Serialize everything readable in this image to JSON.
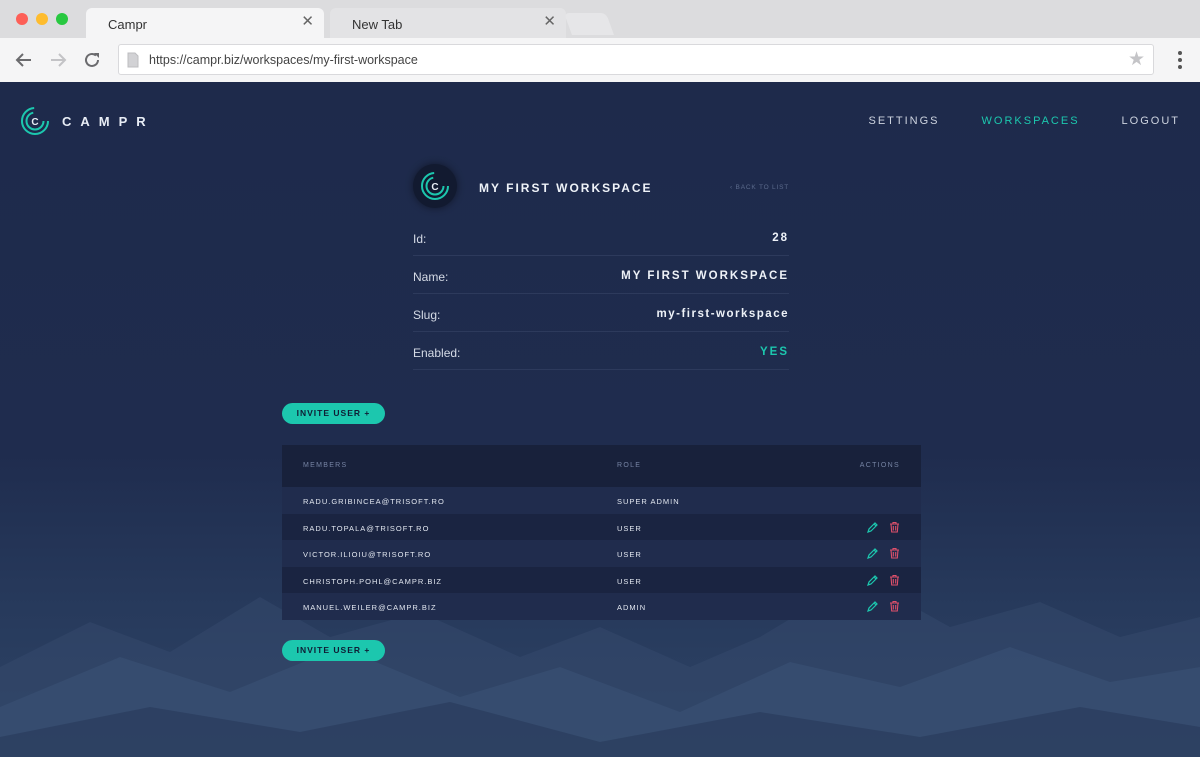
{
  "browser": {
    "tabs": [
      {
        "title": "Campr",
        "active": true
      },
      {
        "title": "New Tab",
        "active": false
      }
    ],
    "url": "https://campr.biz/workspaces/my-first-workspace"
  },
  "app": {
    "logo_text": "CAMPR",
    "nav": [
      {
        "label": "SETTINGS",
        "active": false
      },
      {
        "label": "WORKSPACES",
        "active": true
      },
      {
        "label": "LOGOUT",
        "active": false
      }
    ],
    "accent_color": "#1cc7ae"
  },
  "workspace": {
    "title": "MY FIRST WORKSPACE",
    "back_link": "‹ BACK TO LIST",
    "details": [
      {
        "label": "Id:",
        "value": "28"
      },
      {
        "label": "Name:",
        "value": "MY FIRST WORKSPACE"
      },
      {
        "label": "Slug:",
        "value": "my-first-workspace"
      },
      {
        "label": "Enabled:",
        "value": "YES"
      }
    ]
  },
  "invite_button": "INVITE USER +",
  "members_table": {
    "headers": {
      "members": "MEMBERS",
      "role": "ROLE",
      "actions": "ACTIONS"
    },
    "rows": [
      {
        "email": "RADU.GRIBINCEA@TRISOFT.RO",
        "role": "SUPER ADMIN",
        "actions": []
      },
      {
        "email": "RADU.TOPALA@TRISOFT.RO",
        "role": "USER",
        "actions": [
          "edit-icon",
          "trash-icon"
        ]
      },
      {
        "email": "VICTOR.ILIOIU@TRISOFT.RO",
        "role": "USER",
        "actions": [
          "edit-icon",
          "trash-icon"
        ]
      },
      {
        "email": "CHRISTOPH.POHL@CAMPR.BIZ",
        "role": "USER",
        "actions": [
          "edit-icon",
          "trash-icon"
        ]
      },
      {
        "email": "MANUEL.WEILER@CAMPR.BIZ",
        "role": "ADMIN",
        "actions": [
          "edit-icon",
          "trash-icon"
        ]
      }
    ]
  }
}
